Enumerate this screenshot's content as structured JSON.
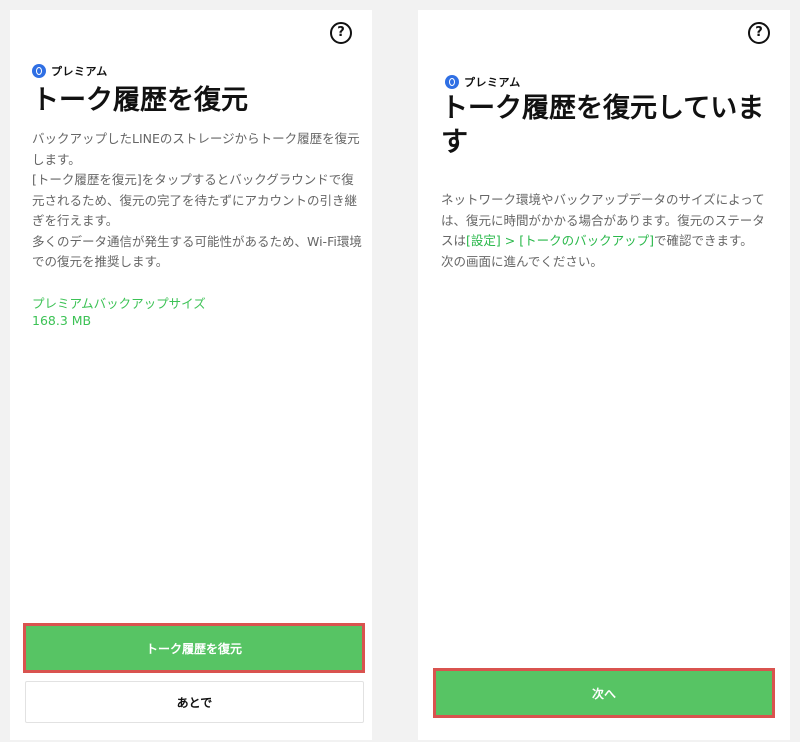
{
  "left": {
    "premium_label": "プレミアム",
    "title": "トーク履歴を復元",
    "description": [
      "バックアップしたLINEのストレージからトーク履歴を復元します。",
      "[トーク履歴を復元]をタップするとバックグラウンドで復元されるため、復元の完了を待たずにアカウントの引き継ぎを行えます。",
      "多くのデータ通信が発生する可能性があるため、Wi-Fi環境での復元を推奨します。"
    ],
    "backup_size_label": "プレミアムバックアップサイズ",
    "backup_size_value": "168.3 MB",
    "restore_button": "トーク履歴を復元",
    "later_button": "あとで",
    "help": "?"
  },
  "right": {
    "premium_label": "プレミアム",
    "title": "トーク履歴を復元しています",
    "desc_part1": "ネットワーク環境やバックアップデータのサイズによっては、復元に時間がかかる場合があります。復元のステータスは",
    "desc_link1": "[設定]",
    "desc_sep": " > ",
    "desc_link2": "[トークのバックアップ]",
    "desc_part2": "で確認できます。",
    "desc_line2": "次の画面に進んでください。",
    "next_button": "次へ",
    "help": "?"
  },
  "colors": {
    "accent_green": "#57c464",
    "highlight_red": "#d9534f",
    "premium_blue": "#2f6fe4"
  }
}
